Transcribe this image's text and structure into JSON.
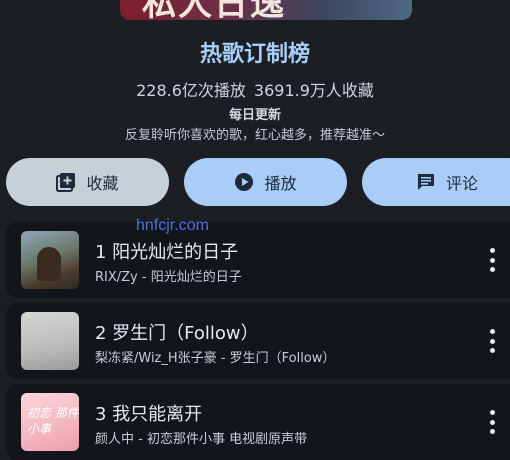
{
  "cover": {
    "partial_text": "私人日逸"
  },
  "header": {
    "title": "热歌订制榜",
    "plays": "228.6亿次播放",
    "favorites": "3691.9万人收藏",
    "update": "每日更新",
    "description": "反复聆听你喜欢的歌，红心越多，推荐越准～"
  },
  "actions": {
    "collect_label": "收藏",
    "play_label": "播放",
    "comment_label": "评论"
  },
  "watermark": "hnfcjr.com",
  "songs": [
    {
      "title": "1 阳光灿烂的日子",
      "subtitle": "RIX/Zy - 阳光灿烂的日子"
    },
    {
      "title": "2 罗生门（Follow）",
      "subtitle": "梨冻紧/Wiz_H张子豪 - 罗生门（Follow）"
    },
    {
      "title": "3 我只能离开",
      "subtitle": "颜人中 - 初恋那件小事 电视剧原声带",
      "cover_text": "初恋 那件小事"
    }
  ],
  "icons": {
    "collect": "playlist-add-icon",
    "play": "play-circle-icon",
    "comment": "comment-icon",
    "more": "more-vert-icon"
  },
  "colors": {
    "accent": "#a9cdf7",
    "background": "#1b1f24",
    "row": "#12161b",
    "watermark": "#4f6fe6"
  }
}
